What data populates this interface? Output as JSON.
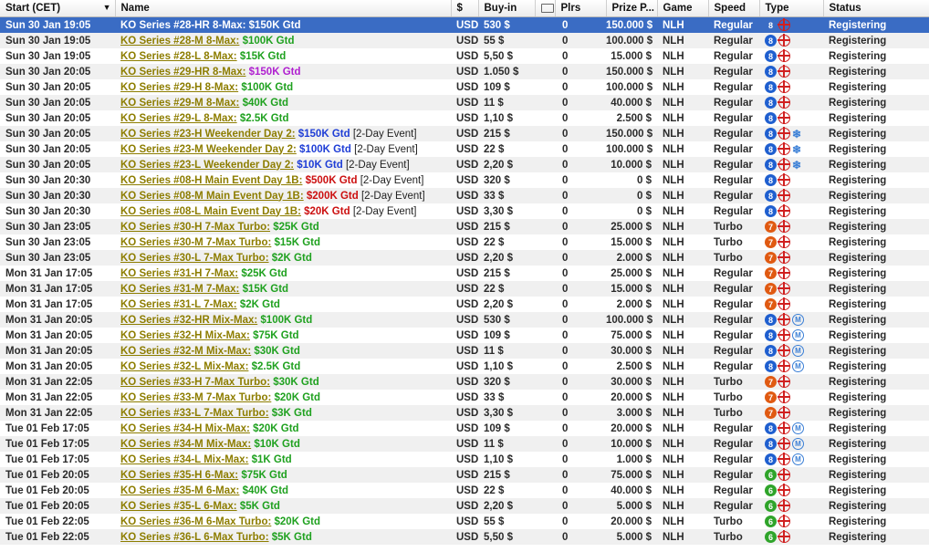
{
  "columns": [
    "Start (CET)",
    "Name",
    "$",
    "Buy-in",
    "",
    "Plrs",
    "Prize P...",
    "Game",
    "Speed",
    "Type",
    "Status"
  ],
  "icons": {
    "sort": "sort-down-arrow-icon",
    "ticket": "ticket-icon",
    "ko": "knockout-crosshair-icon",
    "multiday": "snowflake-icon",
    "mix": "mix-max-icon"
  },
  "colors": {
    "selection": "#3a6cc4",
    "link": "#8d7d00",
    "green": "#1fa11f",
    "blue": "#1f3ed6",
    "red": "#cc1010",
    "purple": "#b020d0"
  },
  "rows": [
    {
      "start": "Sun 30 Jan 19:05",
      "name": "KO Series #28-HR 8-Max:",
      "gtd": "$150K Gtd",
      "gtdColor": "#ffffff",
      "note": "",
      "cur": "USD",
      "buyin": "530 $",
      "plrs": "0",
      "prize": "150.000 $",
      "game": "NLH",
      "speed": "Regular",
      "max": "8",
      "mix": false,
      "multi": false,
      "status": "Registering",
      "sel": true
    },
    {
      "start": "Sun 30 Jan 19:05",
      "name": "KO Series #28-M 8-Max:",
      "gtd": "$100K Gtd",
      "gtdColor": "#1fa11f",
      "note": "",
      "cur": "USD",
      "buyin": "55 $",
      "plrs": "0",
      "prize": "100.000 $",
      "game": "NLH",
      "speed": "Regular",
      "max": "8",
      "mix": false,
      "multi": false,
      "status": "Registering"
    },
    {
      "start": "Sun 30 Jan 19:05",
      "name": "KO Series #28-L 8-Max:",
      "gtd": "$15K Gtd",
      "gtdColor": "#1fa11f",
      "note": "",
      "cur": "USD",
      "buyin": "5,50 $",
      "plrs": "0",
      "prize": "15.000 $",
      "game": "NLH",
      "speed": "Regular",
      "max": "8",
      "mix": false,
      "multi": false,
      "status": "Registering"
    },
    {
      "start": "Sun 30 Jan 20:05",
      "name": "KO Series #29-HR 8-Max:",
      "gtd": "$150K Gtd",
      "gtdColor": "#b020d0",
      "note": "",
      "cur": "USD",
      "buyin": "1.050 $",
      "plrs": "0",
      "prize": "150.000 $",
      "game": "NLH",
      "speed": "Regular",
      "max": "8",
      "mix": false,
      "multi": false,
      "status": "Registering"
    },
    {
      "start": "Sun 30 Jan 20:05",
      "name": "KO Series #29-H 8-Max:",
      "gtd": "$100K Gtd",
      "gtdColor": "#1fa11f",
      "note": "",
      "cur": "USD",
      "buyin": "109 $",
      "plrs": "0",
      "prize": "100.000 $",
      "game": "NLH",
      "speed": "Regular",
      "max": "8",
      "mix": false,
      "multi": false,
      "status": "Registering"
    },
    {
      "start": "Sun 30 Jan 20:05",
      "name": "KO Series #29-M 8-Max:",
      "gtd": "$40K Gtd",
      "gtdColor": "#1fa11f",
      "note": "",
      "cur": "USD",
      "buyin": "11 $",
      "plrs": "0",
      "prize": "40.000 $",
      "game": "NLH",
      "speed": "Regular",
      "max": "8",
      "mix": false,
      "multi": false,
      "status": "Registering"
    },
    {
      "start": "Sun 30 Jan 20:05",
      "name": "KO Series #29-L 8-Max:",
      "gtd": "$2.5K Gtd",
      "gtdColor": "#1fa11f",
      "note": "",
      "cur": "USD",
      "buyin": "1,10 $",
      "plrs": "0",
      "prize": "2.500 $",
      "game": "NLH",
      "speed": "Regular",
      "max": "8",
      "mix": false,
      "multi": false,
      "status": "Registering"
    },
    {
      "start": "Sun 30 Jan 20:05",
      "name": "KO Series #23-H Weekender Day 2:",
      "gtd": "$150K Gtd",
      "gtdColor": "#1f3ed6",
      "note": "[2-Day Event]",
      "cur": "USD",
      "buyin": "215 $",
      "plrs": "0",
      "prize": "150.000 $",
      "game": "NLH",
      "speed": "Regular",
      "max": "8",
      "mix": false,
      "multi": true,
      "status": "Registering"
    },
    {
      "start": "Sun 30 Jan 20:05",
      "name": "KO Series #23-M Weekender Day 2:",
      "gtd": "$100K Gtd",
      "gtdColor": "#1f3ed6",
      "note": "[2-Day Event]",
      "cur": "USD",
      "buyin": "22 $",
      "plrs": "0",
      "prize": "100.000 $",
      "game": "NLH",
      "speed": "Regular",
      "max": "8",
      "mix": false,
      "multi": true,
      "status": "Registering"
    },
    {
      "start": "Sun 30 Jan 20:05",
      "name": "KO Series #23-L Weekender Day 2:",
      "gtd": "$10K Gtd",
      "gtdColor": "#1f3ed6",
      "note": "[2-Day Event]",
      "cur": "USD",
      "buyin": "2,20 $",
      "plrs": "0",
      "prize": "10.000 $",
      "game": "NLH",
      "speed": "Regular",
      "max": "8",
      "mix": false,
      "multi": true,
      "status": "Registering"
    },
    {
      "start": "Sun 30 Jan 20:30",
      "name": "KO Series #08-H Main Event Day 1B:",
      "gtd": "$500K Gtd",
      "gtdColor": "#cc1010",
      "note": "[2-Day Event]",
      "cur": "USD",
      "buyin": "320 $",
      "plrs": "0",
      "prize": "0 $",
      "game": "NLH",
      "speed": "Regular",
      "max": "8",
      "mix": false,
      "multi": false,
      "status": "Registering"
    },
    {
      "start": "Sun 30 Jan 20:30",
      "name": "KO Series #08-M Main Event Day 1B:",
      "gtd": "$200K Gtd",
      "gtdColor": "#cc1010",
      "note": "[2-Day Event]",
      "cur": "USD",
      "buyin": "33 $",
      "plrs": "0",
      "prize": "0 $",
      "game": "NLH",
      "speed": "Regular",
      "max": "8",
      "mix": false,
      "multi": false,
      "status": "Registering"
    },
    {
      "start": "Sun 30 Jan 20:30",
      "name": "KO Series #08-L Main Event Day 1B:",
      "gtd": "$20K Gtd",
      "gtdColor": "#cc1010",
      "note": "[2-Day Event]",
      "cur": "USD",
      "buyin": "3,30 $",
      "plrs": "0",
      "prize": "0 $",
      "game": "NLH",
      "speed": "Regular",
      "max": "8",
      "mix": false,
      "multi": false,
      "status": "Registering"
    },
    {
      "start": "Sun 30 Jan 23:05",
      "name": "KO Series #30-H 7-Max Turbo:",
      "gtd": "$25K Gtd",
      "gtdColor": "#1fa11f",
      "note": "",
      "cur": "USD",
      "buyin": "215 $",
      "plrs": "0",
      "prize": "25.000 $",
      "game": "NLH",
      "speed": "Turbo",
      "max": "7",
      "mix": false,
      "multi": false,
      "status": "Registering"
    },
    {
      "start": "Sun 30 Jan 23:05",
      "name": "KO Series #30-M 7-Max Turbo:",
      "gtd": "$15K Gtd",
      "gtdColor": "#1fa11f",
      "note": "",
      "cur": "USD",
      "buyin": "22 $",
      "plrs": "0",
      "prize": "15.000 $",
      "game": "NLH",
      "speed": "Turbo",
      "max": "7",
      "mix": false,
      "multi": false,
      "status": "Registering"
    },
    {
      "start": "Sun 30 Jan 23:05",
      "name": "KO Series #30-L 7-Max Turbo:",
      "gtd": "$2K Gtd",
      "gtdColor": "#1fa11f",
      "note": "",
      "cur": "USD",
      "buyin": "2,20 $",
      "plrs": "0",
      "prize": "2.000 $",
      "game": "NLH",
      "speed": "Turbo",
      "max": "7",
      "mix": false,
      "multi": false,
      "status": "Registering"
    },
    {
      "start": "Mon 31 Jan 17:05",
      "name": "KO Series #31-H 7-Max:",
      "gtd": "$25K Gtd",
      "gtdColor": "#1fa11f",
      "note": "",
      "cur": "USD",
      "buyin": "215 $",
      "plrs": "0",
      "prize": "25.000 $",
      "game": "NLH",
      "speed": "Regular",
      "max": "7",
      "mix": false,
      "multi": false,
      "status": "Registering"
    },
    {
      "start": "Mon 31 Jan 17:05",
      "name": "KO Series #31-M 7-Max:",
      "gtd": "$15K Gtd",
      "gtdColor": "#1fa11f",
      "note": "",
      "cur": "USD",
      "buyin": "22 $",
      "plrs": "0",
      "prize": "15.000 $",
      "game": "NLH",
      "speed": "Regular",
      "max": "7",
      "mix": false,
      "multi": false,
      "status": "Registering"
    },
    {
      "start": "Mon 31 Jan 17:05",
      "name": "KO Series #31-L 7-Max:",
      "gtd": "$2K Gtd",
      "gtdColor": "#1fa11f",
      "note": "",
      "cur": "USD",
      "buyin": "2,20 $",
      "plrs": "0",
      "prize": "2.000 $",
      "game": "NLH",
      "speed": "Regular",
      "max": "7",
      "mix": false,
      "multi": false,
      "status": "Registering"
    },
    {
      "start": "Mon 31 Jan 20:05",
      "name": "KO Series #32-HR Mix-Max:",
      "gtd": "$100K Gtd",
      "gtdColor": "#1fa11f",
      "note": "",
      "cur": "USD",
      "buyin": "530 $",
      "plrs": "0",
      "prize": "100.000 $",
      "game": "NLH",
      "speed": "Regular",
      "max": "8",
      "mix": true,
      "multi": false,
      "status": "Registering"
    },
    {
      "start": "Mon 31 Jan 20:05",
      "name": "KO Series #32-H Mix-Max:",
      "gtd": "$75K Gtd",
      "gtdColor": "#1fa11f",
      "note": "",
      "cur": "USD",
      "buyin": "109 $",
      "plrs": "0",
      "prize": "75.000 $",
      "game": "NLH",
      "speed": "Regular",
      "max": "8",
      "mix": true,
      "multi": false,
      "status": "Registering"
    },
    {
      "start": "Mon 31 Jan 20:05",
      "name": "KO Series #32-M Mix-Max:",
      "gtd": "$30K Gtd",
      "gtdColor": "#1fa11f",
      "note": "",
      "cur": "USD",
      "buyin": "11 $",
      "plrs": "0",
      "prize": "30.000 $",
      "game": "NLH",
      "speed": "Regular",
      "max": "8",
      "mix": true,
      "multi": false,
      "status": "Registering"
    },
    {
      "start": "Mon 31 Jan 20:05",
      "name": "KO Series #32-L Mix-Max:",
      "gtd": "$2.5K Gtd",
      "gtdColor": "#1fa11f",
      "note": "",
      "cur": "USD",
      "buyin": "1,10 $",
      "plrs": "0",
      "prize": "2.500 $",
      "game": "NLH",
      "speed": "Regular",
      "max": "8",
      "mix": true,
      "multi": false,
      "status": "Registering"
    },
    {
      "start": "Mon 31 Jan 22:05",
      "name": "KO Series #33-H 7-Max Turbo:",
      "gtd": "$30K Gtd",
      "gtdColor": "#1fa11f",
      "note": "",
      "cur": "USD",
      "buyin": "320 $",
      "plrs": "0",
      "prize": "30.000 $",
      "game": "NLH",
      "speed": "Turbo",
      "max": "7",
      "mix": false,
      "multi": false,
      "status": "Registering"
    },
    {
      "start": "Mon 31 Jan 22:05",
      "name": "KO Series #33-M 7-Max Turbo:",
      "gtd": "$20K Gtd",
      "gtdColor": "#1fa11f",
      "note": "",
      "cur": "USD",
      "buyin": "33 $",
      "plrs": "0",
      "prize": "20.000 $",
      "game": "NLH",
      "speed": "Turbo",
      "max": "7",
      "mix": false,
      "multi": false,
      "status": "Registering"
    },
    {
      "start": "Mon 31 Jan 22:05",
      "name": "KO Series #33-L 7-Max Turbo:",
      "gtd": "$3K Gtd",
      "gtdColor": "#1fa11f",
      "note": "",
      "cur": "USD",
      "buyin": "3,30 $",
      "plrs": "0",
      "prize": "3.000 $",
      "game": "NLH",
      "speed": "Turbo",
      "max": "7",
      "mix": false,
      "multi": false,
      "status": "Registering"
    },
    {
      "start": "Tue 01 Feb 17:05",
      "name": "KO Series #34-H Mix-Max:",
      "gtd": "$20K Gtd",
      "gtdColor": "#1fa11f",
      "note": "",
      "cur": "USD",
      "buyin": "109 $",
      "plrs": "0",
      "prize": "20.000 $",
      "game": "NLH",
      "speed": "Regular",
      "max": "8",
      "mix": true,
      "multi": false,
      "status": "Registering"
    },
    {
      "start": "Tue 01 Feb 17:05",
      "name": "KO Series #34-M Mix-Max:",
      "gtd": "$10K Gtd",
      "gtdColor": "#1fa11f",
      "note": "",
      "cur": "USD",
      "buyin": "11 $",
      "plrs": "0",
      "prize": "10.000 $",
      "game": "NLH",
      "speed": "Regular",
      "max": "8",
      "mix": true,
      "multi": false,
      "status": "Registering"
    },
    {
      "start": "Tue 01 Feb 17:05",
      "name": "KO Series #34-L Mix-Max:",
      "gtd": "$1K Gtd",
      "gtdColor": "#1fa11f",
      "note": "",
      "cur": "USD",
      "buyin": "1,10 $",
      "plrs": "0",
      "prize": "1.000 $",
      "game": "NLH",
      "speed": "Regular",
      "max": "8",
      "mix": true,
      "multi": false,
      "status": "Registering"
    },
    {
      "start": "Tue 01 Feb 20:05",
      "name": "KO Series #35-H 6-Max:",
      "gtd": "$75K Gtd",
      "gtdColor": "#1fa11f",
      "note": "",
      "cur": "USD",
      "buyin": "215 $",
      "plrs": "0",
      "prize": "75.000 $",
      "game": "NLH",
      "speed": "Regular",
      "max": "6",
      "mix": false,
      "multi": false,
      "status": "Registering"
    },
    {
      "start": "Tue 01 Feb 20:05",
      "name": "KO Series #35-M 6-Max:",
      "gtd": "$40K Gtd",
      "gtdColor": "#1fa11f",
      "note": "",
      "cur": "USD",
      "buyin": "22 $",
      "plrs": "0",
      "prize": "40.000 $",
      "game": "NLH",
      "speed": "Regular",
      "max": "6",
      "mix": false,
      "multi": false,
      "status": "Registering"
    },
    {
      "start": "Tue 01 Feb 20:05",
      "name": "KO Series #35-L 6-Max:",
      "gtd": "$5K Gtd",
      "gtdColor": "#1fa11f",
      "note": "",
      "cur": "USD",
      "buyin": "2,20 $",
      "plrs": "0",
      "prize": "5.000 $",
      "game": "NLH",
      "speed": "Regular",
      "max": "6",
      "mix": false,
      "multi": false,
      "status": "Registering"
    },
    {
      "start": "Tue 01 Feb 22:05",
      "name": "KO Series #36-M 6-Max Turbo:",
      "gtd": "$20K Gtd",
      "gtdColor": "#1fa11f",
      "note": "",
      "cur": "USD",
      "buyin": "55 $",
      "plrs": "0",
      "prize": "20.000 $",
      "game": "NLH",
      "speed": "Turbo",
      "max": "6",
      "mix": false,
      "multi": false,
      "status": "Registering"
    },
    {
      "start": "Tue 01 Feb 22:05",
      "name": "KO Series #36-L 6-Max Turbo:",
      "gtd": "$5K Gtd",
      "gtdColor": "#1fa11f",
      "note": "",
      "cur": "USD",
      "buyin": "5,50 $",
      "plrs": "0",
      "prize": "5.000 $",
      "game": "NLH",
      "speed": "Turbo",
      "max": "6",
      "mix": false,
      "multi": false,
      "status": "Registering"
    }
  ]
}
